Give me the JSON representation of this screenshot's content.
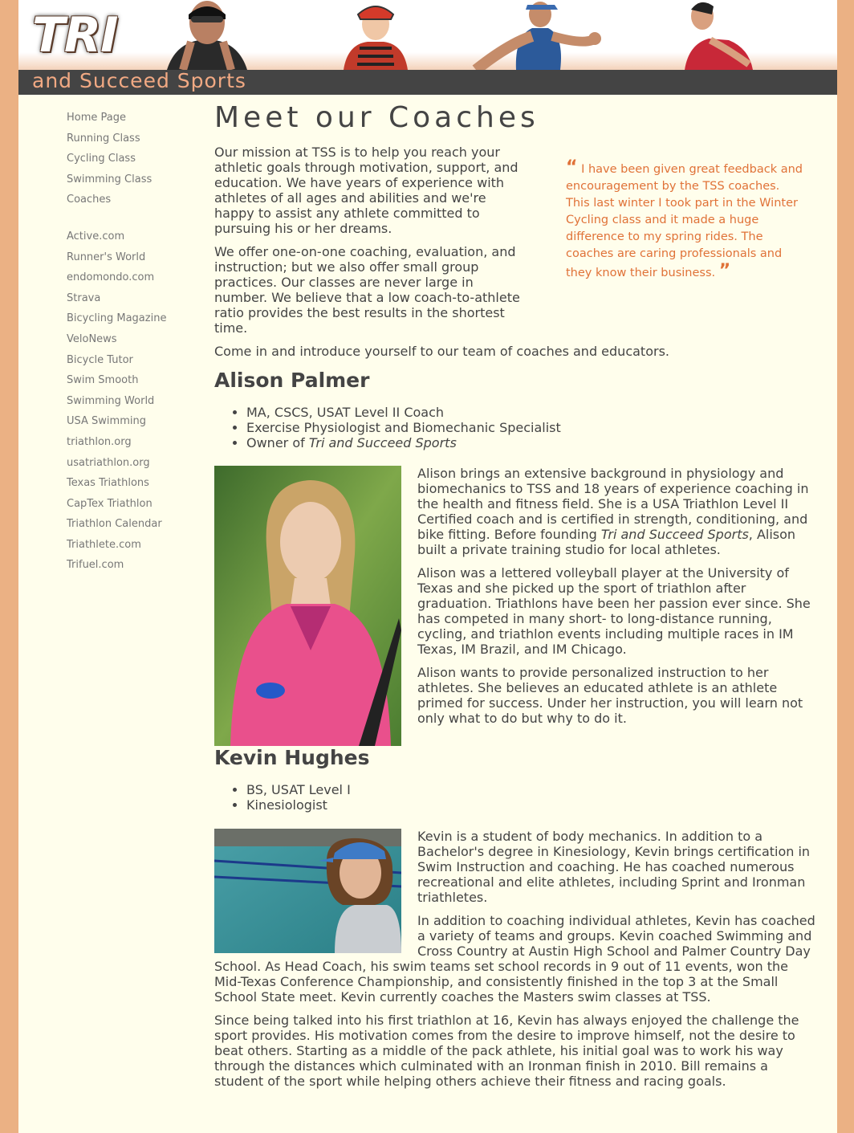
{
  "header": {
    "logo": "TRI",
    "tagline": "and Succeed Sports"
  },
  "sidebar": {
    "classes": [
      "Home Page",
      "Running Class",
      "Cycling Class",
      "Swimming Class",
      "Coaches"
    ],
    "links": [
      "Active.com",
      "Runner's World",
      "endomondo.com",
      "Strava",
      "Bicycling Magazine",
      "VeloNews",
      "Bicycle Tutor",
      "Swim Smooth",
      "Swimming World",
      "USA Swimming",
      "triathlon.org",
      "usatriathlon.org",
      "Texas Triathlons",
      "CapTex Triathlon",
      "Triathlon Calendar",
      "Triathlete.com",
      "Trifuel.com"
    ]
  },
  "main": {
    "title": "Meet our Coaches",
    "intro": [
      "Our mission at TSS is to help you reach your athletic goals through motivation, support, and education. We have years of experience with athletes of all ages and abilities and we're happy to assist any athlete committed to pursuing his or her dreams.",
      "We offer one-on-one coaching, evaluation, and instruction; but we also offer small group practices. Our classes are never large in number. We believe that a low coach-to-athlete ratio provides the best results in the shortest time."
    ],
    "welcome": "Come in and introduce yourself to our team of coaches and educators.",
    "quote": "I have been given great feedback and encouragement by the TSS coaches. This last winter I took part in the Winter Cycling class and it made a huge difference to my spring rides. The coaches are caring professionals and they know their business.",
    "coach1": {
      "name": "Alison Palmer",
      "cred1": "MA, CSCS, USAT Level II Coach",
      "cred2": "Exercise Physiologist and Biomechanic Specialist",
      "cred3_prefix": "Owner of ",
      "cred3_em": "Tri and Succeed Sports",
      "p1_a": "Alison brings an extensive background in physiology and biomechanics to TSS and 18 years of experience coaching in the health and fitness field. She is a USA Triathlon Level II Certified coach and is certified in strength, conditioning, and bike fitting. Before founding ",
      "p1_em": "Tri and Succeed Sports",
      "p1_b": ", Alison built a private training studio for local athletes.",
      "p2": "Alison was a lettered volleyball player at the University of Texas and she picked up the sport of triathlon after graduation. Triathlons have been her passion ever since. She has competed in many short- to long-distance running, cycling, and triathlon events including multiple races in IM Texas, IM Brazil, and IM Chicago.",
      "p3": "Alison wants to provide personalized instruction to her athletes. She believes an educated athlete is an athlete primed for success. Under her instruction, you will learn not only what to do but why to do it."
    },
    "coach2": {
      "name": "Kevin Hughes",
      "cred1": "BS, USAT Level I",
      "cred2": "Kinesiologist",
      "p1": "Kevin is a student of body mechanics. In addition to a Bachelor's degree in Kinesiology, Kevin brings certification in Swim Instruction and coaching. He has coached numerous recreational and elite athletes, including Sprint and Ironman triathletes.",
      "p2": "In addition to coaching individual athletes, Kevin has coached a variety of teams and groups. Kevin coached Swimming and Cross Country at Austin High School and Palmer Country Day School. As Head Coach, his swim teams set school records in 9 out of 11 events, won the Mid-Texas Conference Championship, and consistently finished in the top 3 at the Small School State meet. Kevin currently coaches the Masters swim classes at TSS.",
      "p3": "Since being talked into his first triathlon at 16, Kevin has always enjoyed the challenge the sport provides. His motivation comes from the desire to improve himself, not the desire to beat others. Starting as a middle of the pack athlete, his initial goal was to work his way through the distances which culminated with an Ironman finish in 2010. Bill remains a student of the sport while helping others achieve their fitness and racing goals."
    }
  }
}
